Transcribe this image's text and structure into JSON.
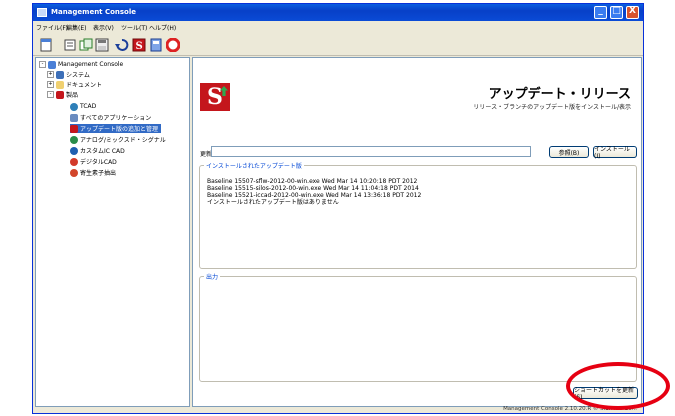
{
  "window": {
    "title": "Management Console",
    "controls": {
      "minimize": "_",
      "maximize": "□",
      "close": "X"
    }
  },
  "menu": {
    "items": [
      "ファイル(F)",
      "編集(E)",
      "表示(V)",
      "ツール(T)",
      "ヘルプ(H)"
    ]
  },
  "toolbar": {
    "icons": [
      "new-icon",
      "open-icon",
      "copy-icon",
      "save-icon",
      "refresh-icon",
      "silvaco-icon",
      "book-icon",
      "help-icon"
    ]
  },
  "tree": {
    "root": "Management Console",
    "system": "システム",
    "documents": "ドキュメント",
    "products": "製品",
    "tcad": "TCAD",
    "all_apps": "すべてのアプリケーション",
    "update_manage": "アップデート版の追加と管理",
    "analog": "アナログ/ミックスド・シグナル",
    "custom_ic": "カスタムIC CAD",
    "digital": "デジタルCAD",
    "parasitic": "寄生素子抽出"
  },
  "main": {
    "logo": "S",
    "title": "アップデート・リリース",
    "subtitle": "リリース・ブランチのアップデート版をインストール/表示",
    "update_label": "更新:",
    "update_value": "",
    "browse_button": "参照(B)",
    "install_button": "インストール(I)",
    "installed_legend": "インストールされたアップデート版",
    "installed_lines": [
      "Baseline 15507-sflw-2012-00-win.exe Wed Mar 14 10:20:18 PDT 2012",
      "Baseline 15515-silos-2012-00-win.exe Wed Mar 14 11:04:18 PDT 2014",
      "Baseline 15521-iccad-2012-00-win.exe Wed Mar 14 13:36:18 PDT 2012",
      "インストールされたアップデート版はありません"
    ],
    "output_legend": "出力",
    "update_shortcut_button": "ショートカットを更新(S)"
  },
  "status": {
    "text": "Management Console 2.10.20.R © SILVACO 20..."
  },
  "colors": {
    "titlebar": "#0a5fe0",
    "selection": "#316ac5",
    "brand_red": "#c4161c",
    "annotation_circle": "#e60012"
  }
}
